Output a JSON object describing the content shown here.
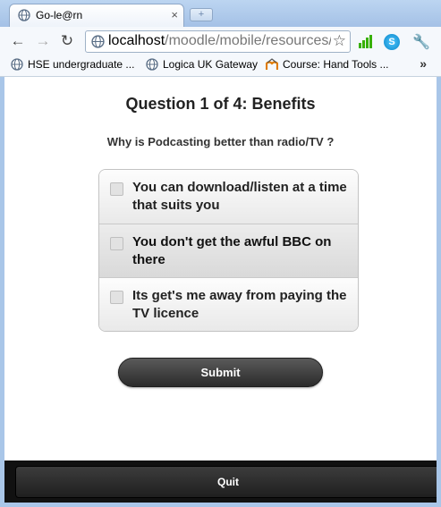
{
  "browser": {
    "tab_title": "Go-le@rn",
    "tab_close": "×",
    "new_tab": "+",
    "url_host": "localhost",
    "url_path": "/moodle/mobile/resources/",
    "nav": {
      "back": "←",
      "forward": "→",
      "reload": "↻"
    },
    "star": "☆",
    "wrench": "🔧",
    "skype_letter": "S",
    "bookmarks": [
      {
        "label": "HSE undergraduate ...",
        "icon": "globe-icon"
      },
      {
        "label": "Logica UK Gateway",
        "icon": "globe-icon"
      },
      {
        "label": "Course: Hand Tools ...",
        "icon": "moodle-icon"
      }
    ],
    "bookmarks_more": "»"
  },
  "quiz": {
    "title": "Question 1 of 4: Benefits",
    "question": "Why is Podcasting better than radio/TV ?",
    "options": [
      {
        "label": "You can download/listen at a time that suits you",
        "checked": false
      },
      {
        "label": "You don't get the awful BBC on there",
        "checked": false
      },
      {
        "label": "Its get's me away from paying the TV licence",
        "checked": false
      }
    ],
    "submit_label": "Submit",
    "quit_label": "Quit"
  },
  "colors": {
    "frame": "#a9c6e8",
    "button_dark": "#2b2b2b",
    "footer": "#111111",
    "signal_green": "#38b000"
  }
}
